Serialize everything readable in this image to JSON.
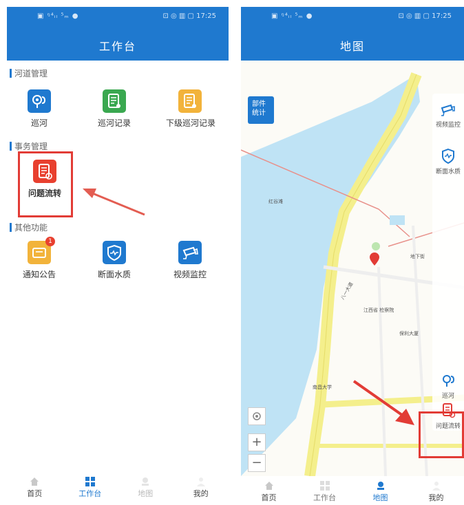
{
  "left_screen": {
    "status_left": "▣ ᵑ⁴ᵢₗ ⁵ₘ ●",
    "status_right": "⊡ ◎ ▥ ▢ 17:25",
    "title": "工作台",
    "sections": [
      {
        "title": "河道管理",
        "items": [
          {
            "label": "巡河",
            "icon": "patrol-pin-icon",
            "color": "#1f79cf"
          },
          {
            "label": "巡河记录",
            "icon": "document-icon",
            "color": "#3aa850"
          },
          {
            "label": "下级巡河记录",
            "icon": "document-icon",
            "color": "#f2b33b"
          }
        ]
      },
      {
        "title": "事务管理",
        "items": [
          {
            "label": "问题流转",
            "icon": "document-check-icon",
            "color": "#e8402f"
          }
        ]
      },
      {
        "title": "其他功能",
        "items": [
          {
            "label": "通知公告",
            "icon": "notice-icon",
            "color": "#f2b33b",
            "badge": "1"
          },
          {
            "label": "断面水质",
            "icon": "shield-wave-icon",
            "color": "#1f79cf"
          },
          {
            "label": "视频监控",
            "icon": "camera-icon",
            "color": "#1f79cf"
          }
        ]
      }
    ],
    "tabs": [
      {
        "label": "首页",
        "active": false
      },
      {
        "label": "工作台",
        "active": true
      },
      {
        "label": "地图",
        "active": false
      },
      {
        "label": "我的",
        "active": false
      }
    ]
  },
  "right_screen": {
    "status_left": "▣ ᵑ⁴ᵢₗ ⁵ₘ ●",
    "status_right": "⊡ ◎ ▥ ▢ 17:25",
    "title": "地图",
    "stat_button": "部件\n统计",
    "side_items": [
      {
        "label": "视频监控",
        "icon": "camera-icon"
      },
      {
        "label": "断面水质",
        "icon": "shield-wave-icon"
      },
      {
        "label": "巡河",
        "icon": "patrol-pin-icon"
      },
      {
        "label": "问题流转",
        "icon": "document-check-icon"
      }
    ],
    "zoom_in": "+",
    "zoom_out": "−",
    "map_labels": [
      "地下街",
      "江西省 检察院",
      "保利大厦",
      "南昌大学",
      "八一大道",
      "红谷滩"
    ],
    "tabs": [
      {
        "label": "首页",
        "active": false
      },
      {
        "label": "工作台",
        "active": false
      },
      {
        "label": "地图",
        "active": true
      },
      {
        "label": "我的",
        "active": false
      }
    ]
  },
  "colors": {
    "primary": "#1f79cf",
    "highlight": "#e23c36",
    "road": "#f4ef8c",
    "water": "#bfe3f5"
  }
}
